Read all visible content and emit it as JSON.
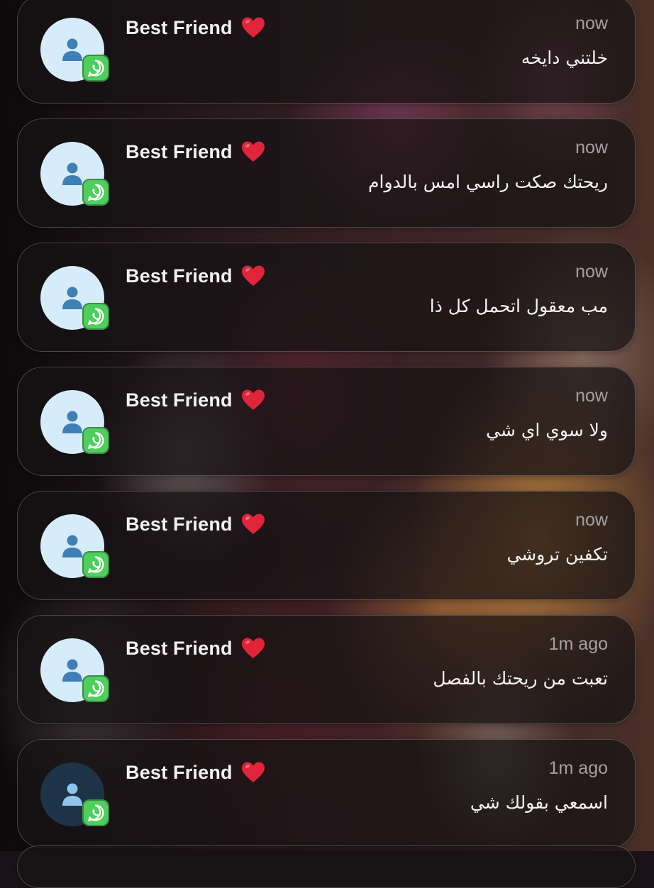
{
  "notifications": [
    {
      "sender": "Best Friend",
      "time": "now",
      "message": "خلتني دايخه",
      "app_icon": "whatsapp-icon",
      "avatar_style": "light"
    },
    {
      "sender": "Best Friend",
      "time": "now",
      "message": "ريحتك صكت راسي امس بالدوام",
      "app_icon": "whatsapp-icon",
      "avatar_style": "light"
    },
    {
      "sender": "Best Friend",
      "time": "now",
      "message": "مب معقول اتحمل كل ذا",
      "app_icon": "whatsapp-icon",
      "avatar_style": "light"
    },
    {
      "sender": "Best Friend",
      "time": "now",
      "message": "ولا سوي اي شي",
      "app_icon": "whatsapp-icon",
      "avatar_style": "light"
    },
    {
      "sender": "Best Friend",
      "time": "now",
      "message": "تكفين تروشي",
      "app_icon": "whatsapp-icon",
      "avatar_style": "light"
    },
    {
      "sender": "Best Friend",
      "time": "1m ago",
      "message": "تعبت من ريحتك بالفصل",
      "app_icon": "whatsapp-icon",
      "avatar_style": "light"
    },
    {
      "sender": "Best Friend",
      "time": "1m ago",
      "message": "اسمعي بقولك شي",
      "app_icon": "whatsapp-icon",
      "avatar_style": "dark"
    }
  ],
  "colors": {
    "whatsapp_green": "#4fce5d",
    "avatar_light": "#d6ecfa",
    "avatar_dark": "#1d3348",
    "person_glyph_light": "#3f7fb5",
    "person_glyph_dark": "#8fc4ec",
    "heart": "#e0243a"
  },
  "icons": {
    "heart": "red-heart-icon",
    "avatar": "person-icon"
  }
}
